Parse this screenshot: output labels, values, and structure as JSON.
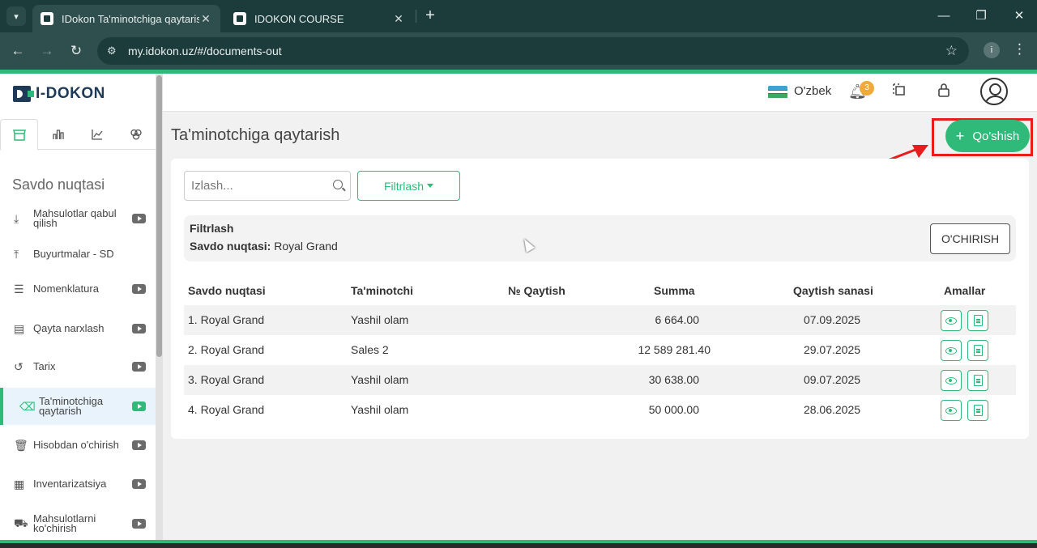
{
  "browser": {
    "tabs": [
      {
        "title": "IDokon Ta'minotchiga qaytarish",
        "active": true
      },
      {
        "title": "IDOKON COURSE",
        "active": false
      }
    ],
    "url": "my.idokon.uz/#/documents-out",
    "profile_initial": "i",
    "new_tab_glyph": "+",
    "close_glyph": "✕"
  },
  "brand": {
    "name": "I-DOKON",
    "accent": "#2fba7a",
    "dark": "#1f3a57"
  },
  "sidebar": {
    "tabs": [
      "store-icon",
      "bar-chart-icon",
      "line-chart-icon",
      "circles-icon"
    ],
    "section_title": "Savdo nuqtasi",
    "items": [
      {
        "label": "Mahsulotlar qabul qilish",
        "icon": "download-box-icon",
        "video": true,
        "active": false
      },
      {
        "label": "Buyurtmalar - SD",
        "icon": "upload-box-icon",
        "video": false,
        "active": false
      },
      {
        "label": "Nomenklatura",
        "icon": "list-icon",
        "video": true,
        "active": false
      },
      {
        "label": "Qayta narxlash",
        "icon": "price-list-icon",
        "video": true,
        "active": false
      },
      {
        "label": "Tarix",
        "icon": "history-icon",
        "video": true,
        "active": false
      },
      {
        "label": "Ta'minotchiga qaytarish",
        "icon": "return-icon",
        "video": true,
        "active": true
      },
      {
        "label": "Hisobdan o'chirish",
        "icon": "trash-icon",
        "video": true,
        "active": false
      },
      {
        "label": "Inventarizatsiya",
        "icon": "grid-icon",
        "video": true,
        "active": false
      },
      {
        "label": "Mahsulotlarni ko'chirish",
        "icon": "truck-icon",
        "video": true,
        "active": false
      }
    ]
  },
  "header": {
    "language": "O'zbek",
    "notification_count": "3"
  },
  "page": {
    "title": "Ta'minotchiga qaytarish",
    "add_label": "Qo'shish"
  },
  "toolbar": {
    "search_placeholder": "Izlash...",
    "filter_label": "Filtrlash"
  },
  "filter_panel": {
    "title": "Filtrlash",
    "key": "Savdo nuqtasi:",
    "value": " Royal Grand",
    "clear_label": "O'CHIRISH"
  },
  "table": {
    "columns": [
      "Savdo nuqtasi",
      "Ta'minotchi",
      "№ Qaytish",
      "Summa",
      "Qaytish sanasi",
      "Amallar"
    ],
    "rows": [
      {
        "store": "1. Royal Grand",
        "supplier": "Yashil olam",
        "number": "",
        "sum": "6 664.00",
        "date": "07.09.2025"
      },
      {
        "store": "2. Royal Grand",
        "supplier": "Sales 2",
        "number": "",
        "sum": "12 589 281.40",
        "date": "29.07.2025"
      },
      {
        "store": "3. Royal Grand",
        "supplier": "Yashil olam",
        "number": "",
        "sum": "30 638.00",
        "date": "09.07.2025"
      },
      {
        "store": "4. Royal Grand",
        "supplier": "Yashil olam",
        "number": "",
        "sum": "50 000.00",
        "date": "28.06.2025"
      }
    ]
  }
}
